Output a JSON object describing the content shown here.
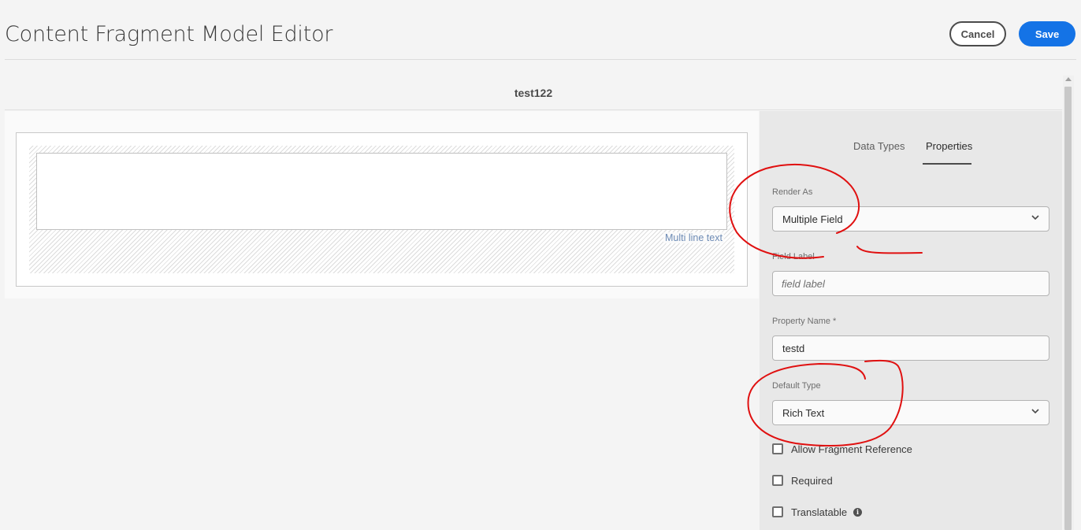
{
  "header": {
    "title": "Content Fragment Model Editor",
    "cancel_label": "Cancel",
    "save_label": "Save"
  },
  "model": {
    "name": "test122"
  },
  "canvas": {
    "field_type_label": "Multi line text"
  },
  "panel": {
    "tabs": [
      {
        "label": "Data Types",
        "active": false
      },
      {
        "label": "Properties",
        "active": true
      }
    ],
    "render_as": {
      "label": "Render As",
      "value": "Multiple Field"
    },
    "field_label": {
      "label": "Field Label",
      "placeholder": "field label",
      "value": ""
    },
    "property_name": {
      "label": "Property Name *",
      "value": "testd"
    },
    "default_type": {
      "label": "Default Type",
      "value": "Rich Text"
    },
    "checkboxes": [
      {
        "label": "Allow Fragment Reference",
        "checked": false
      },
      {
        "label": "Required",
        "checked": false
      },
      {
        "label": "Translatable",
        "checked": false
      }
    ]
  },
  "colors": {
    "accent": "#1473e6",
    "annotation": "#e01010"
  },
  "icons": {
    "select_chevron": "chevron-down-icon",
    "info": "info-icon"
  }
}
